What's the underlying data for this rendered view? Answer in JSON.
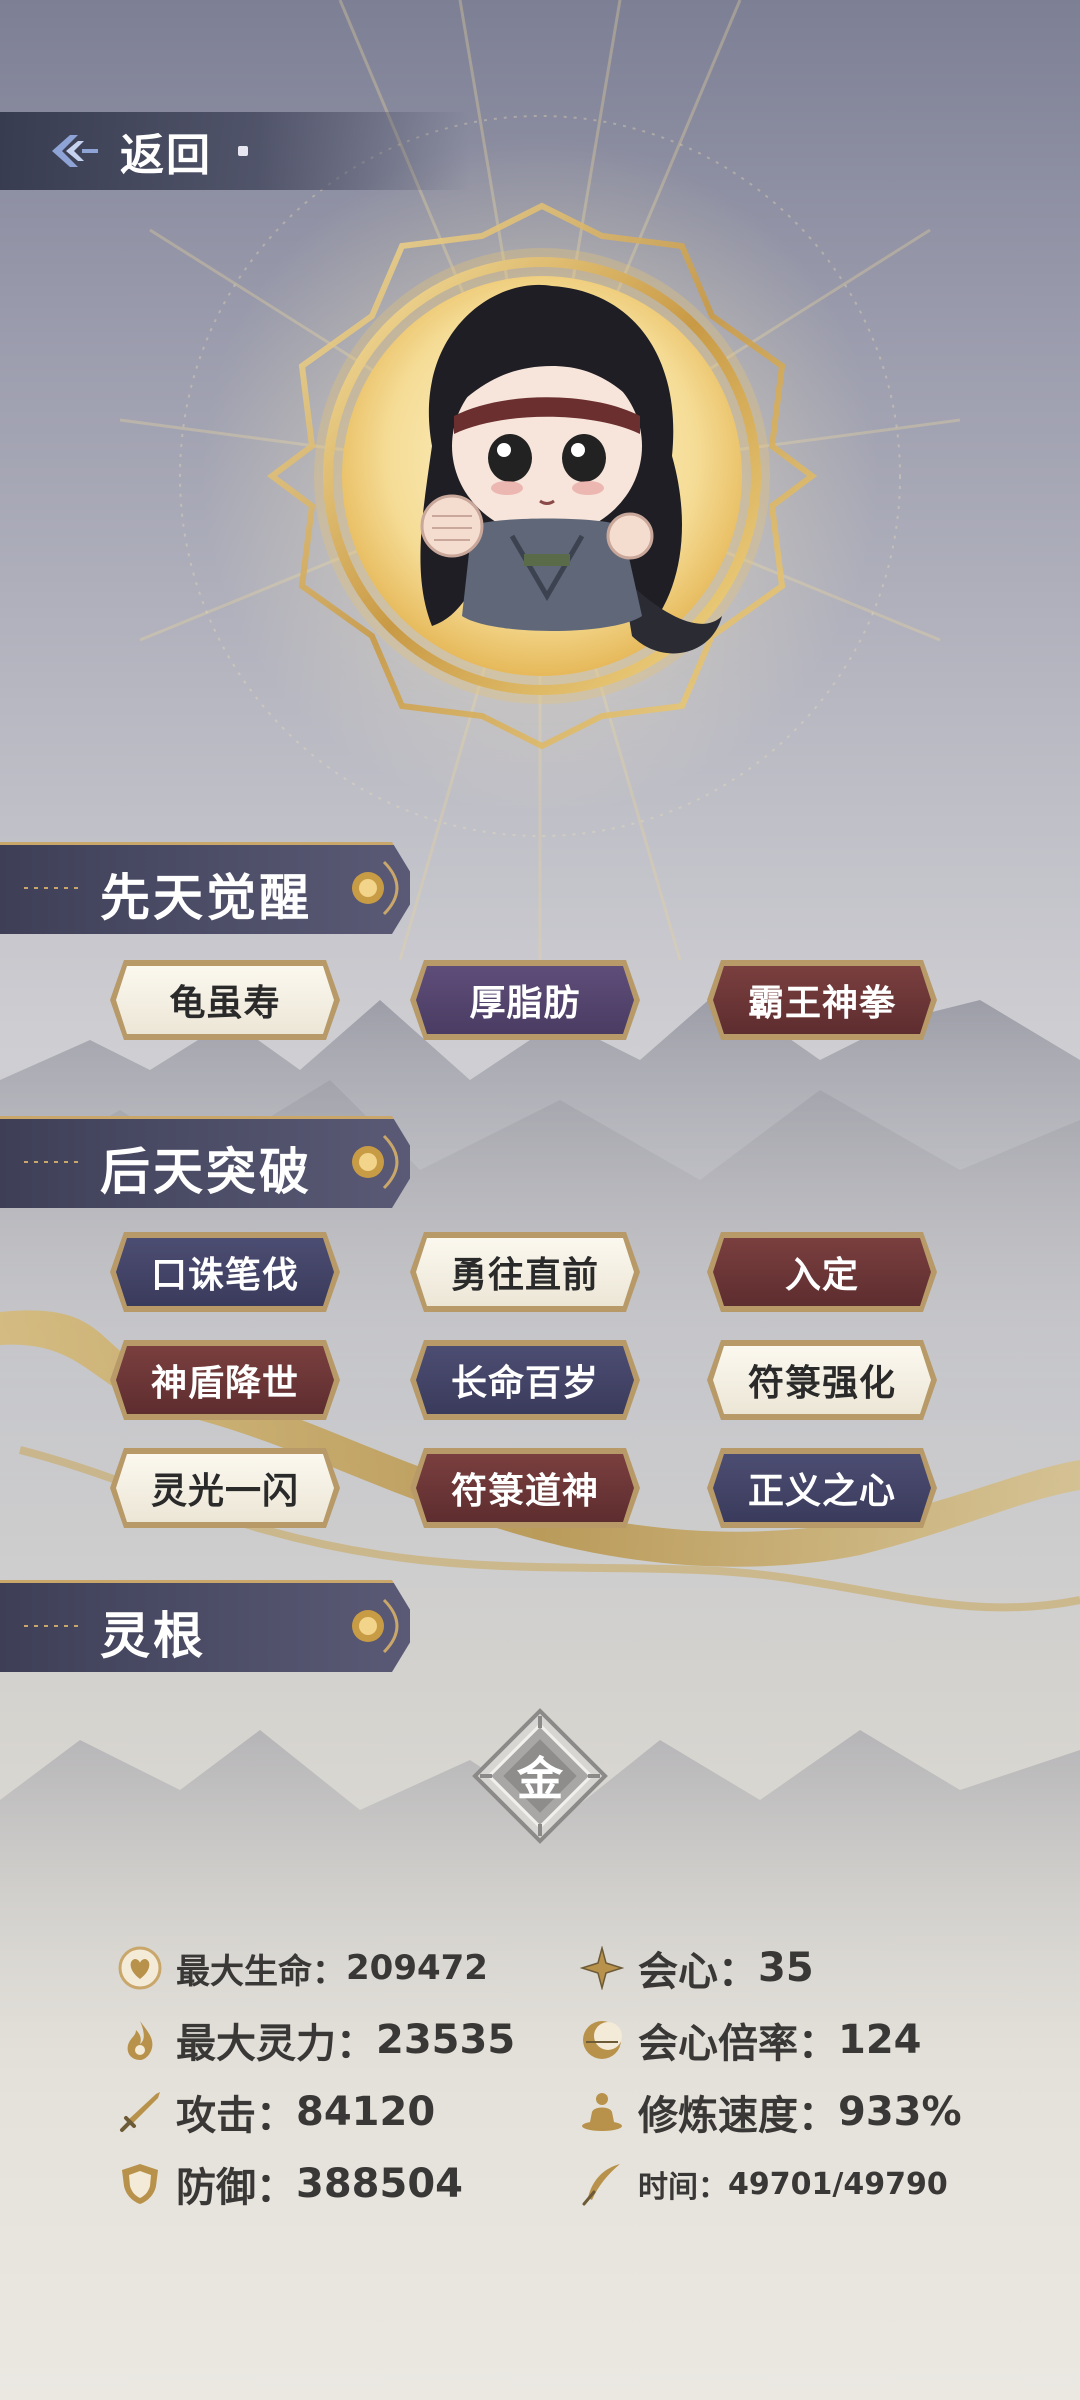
{
  "header": {
    "back_label": "返回"
  },
  "sections": {
    "innate": {
      "title": "先天觉醒",
      "tags": [
        {
          "label": "龟虽寿",
          "style": "white"
        },
        {
          "label": "厚脂肪",
          "style": "purple"
        },
        {
          "label": "霸王神拳",
          "style": "red"
        }
      ]
    },
    "acquired": {
      "title": "后天突破",
      "tags": [
        {
          "label": "口诛笔伐",
          "style": "navy"
        },
        {
          "label": "勇往直前",
          "style": "white"
        },
        {
          "label": "入定",
          "style": "red"
        },
        {
          "label": "神盾降世",
          "style": "red"
        },
        {
          "label": "长命百岁",
          "style": "navy"
        },
        {
          "label": "符箓强化",
          "style": "white"
        },
        {
          "label": "灵光一闪",
          "style": "white"
        },
        {
          "label": "符箓道神",
          "style": "red"
        },
        {
          "label": "正义之心",
          "style": "navy"
        }
      ]
    },
    "spirit_root": {
      "title": "灵根",
      "element": "金"
    }
  },
  "stats": {
    "max_hp": {
      "label": "最大生命：",
      "value": "209472",
      "icon": "heart-icon"
    },
    "crit": {
      "label": "会心：",
      "value": "35",
      "icon": "starburst-icon"
    },
    "max_spirit": {
      "label": "最大灵力：",
      "value": "23535",
      "icon": "flame-icon"
    },
    "crit_rate": {
      "label": "会心倍率：",
      "value": "124",
      "icon": "crescent-icon"
    },
    "attack": {
      "label": "攻击：",
      "value": "84120",
      "icon": "sword-icon"
    },
    "cultivation_speed": {
      "label": "修炼速度：",
      "value": "933%",
      "icon": "meditation-icon"
    },
    "defense": {
      "label": "防御：",
      "value": "388504",
      "icon": "shield-icon"
    },
    "time": {
      "label": "时间：",
      "value": "49701/49790",
      "icon": "feather-icon"
    }
  },
  "colors": {
    "header_bg": "#3e3f57",
    "gold_accent": "#c9a66a",
    "tag_white": "#f5f1e6",
    "tag_purple": "#54456e",
    "tag_red": "#6c3536",
    "tag_navy": "#434466"
  }
}
